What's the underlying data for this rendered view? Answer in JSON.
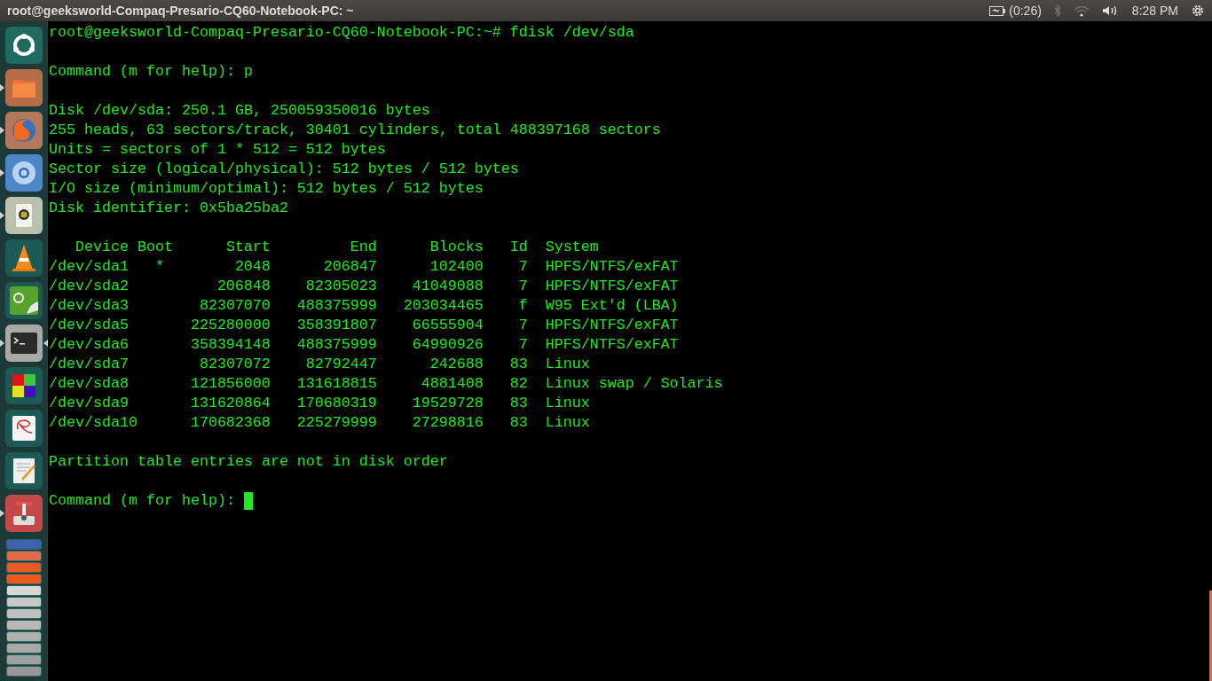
{
  "top_bar": {
    "title": "root@geeksworld-Compaq-Presario-CQ60-Notebook-PC: ~",
    "battery": "(0:26)",
    "clock": "8:28 PM"
  },
  "launcher": {
    "items": [
      {
        "kind": "ubuntu",
        "running": false,
        "focused": false
      },
      {
        "kind": "files",
        "running": true,
        "focused": false
      },
      {
        "kind": "firefox",
        "running": true,
        "focused": false
      },
      {
        "kind": "chromium",
        "running": true,
        "focused": false
      },
      {
        "kind": "speaker",
        "running": true,
        "focused": false
      },
      {
        "kind": "cone",
        "running": false,
        "focused": false
      },
      {
        "kind": "qt",
        "running": false,
        "focused": false
      },
      {
        "kind": "terminal",
        "running": true,
        "focused": true
      },
      {
        "kind": "squares",
        "running": false,
        "focused": false
      },
      {
        "kind": "document",
        "running": false,
        "focused": false
      },
      {
        "kind": "editor",
        "running": false,
        "focused": false
      },
      {
        "kind": "joystick",
        "running": true,
        "focused": false
      }
    ]
  },
  "terminal": {
    "blocks": [
      [
        "root@geeksworld-Compaq-Presario-CQ60-Notebook-PC:~# fdisk /dev/sda"
      ],
      [
        "Command (m for help): p"
      ],
      [
        "Disk /dev/sda: 250.1 GB, 250059350016 bytes",
        "255 heads, 63 sectors/track, 30401 cylinders, total 488397168 sectors",
        "Units = sectors of 1 * 512 = 512 bytes",
        "Sector size (logical/physical): 512 bytes / 512 bytes",
        "I/O size (minimum/optimal): 512 bytes / 512 bytes",
        "Disk identifier: 0x5ba25ba2"
      ]
    ],
    "table": {
      "columns": [
        "Device",
        "Boot",
        "Start",
        "End",
        "Blocks",
        "Id",
        "System"
      ],
      "rows": [
        [
          "/dev/sda1",
          "*",
          "2048",
          "206847",
          "102400",
          "7",
          "HPFS/NTFS/exFAT"
        ],
        [
          "/dev/sda2",
          "",
          "206848",
          "82305023",
          "41049088",
          "7",
          "HPFS/NTFS/exFAT"
        ],
        [
          "/dev/sda3",
          "",
          "82307070",
          "488375999",
          "203034465",
          "f",
          "W95 Ext'd (LBA)"
        ],
        [
          "/dev/sda5",
          "",
          "225280000",
          "358391807",
          "66555904",
          "7",
          "HPFS/NTFS/exFAT"
        ],
        [
          "/dev/sda6",
          "",
          "358394148",
          "488375999",
          "64990926",
          "7",
          "HPFS/NTFS/exFAT"
        ],
        [
          "/dev/sda7",
          "",
          "82307072",
          "82792447",
          "242688",
          "83",
          "Linux"
        ],
        [
          "/dev/sda8",
          "",
          "121856000",
          "131618815",
          "4881408",
          "82",
          "Linux swap / Solaris"
        ],
        [
          "/dev/sda9",
          "",
          "131620864",
          "170680319",
          "19529728",
          "83",
          "Linux"
        ],
        [
          "/dev/sda10",
          "",
          "170682368",
          "225279999",
          "27298816",
          "83",
          "Linux"
        ]
      ]
    },
    "after": [
      "Partition table entries are not in disk order"
    ],
    "prompt": "Command (m for help):",
    "cursor": true
  }
}
